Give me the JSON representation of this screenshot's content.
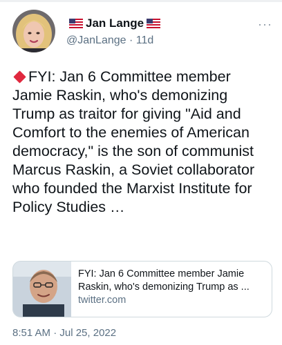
{
  "author": {
    "display_name": "Jan Lange",
    "handle": "@JanLange",
    "separator": " · ",
    "time_ago": "11d",
    "left_flag_icon": "us-flag-icon",
    "right_flag_icon": "us-flag-icon",
    "more_icon": "more-options-icon",
    "more_label": "···"
  },
  "tweet": {
    "lead_icon": "red-diamond-icon",
    "text": "FYI: Jan 6 Committee member Jamie Raskin, who's demonizing Trump as traitor for giving \"Aid and Comfort to the enemies of American democracy,\" is the son of communist Marcus Raskin, a Soviet collaborator who founded the Marxist Institute for Policy Studies …"
  },
  "card": {
    "line1": "FYI: Jan 6 Committee member Jamie",
    "line2": "Raskin, who's demonizing Trump as ...",
    "domain": "twitter.com"
  },
  "timestamp": "8:51 AM · Jul 25, 2022",
  "colors": {
    "text": "#0f1419",
    "secondary": "#5b7083",
    "border": "#cfd9de",
    "diamond": "#e0283e"
  }
}
